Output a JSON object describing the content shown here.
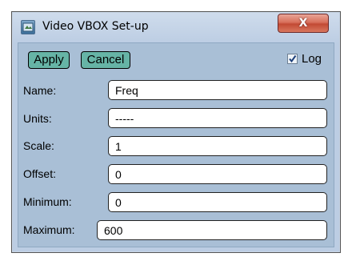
{
  "window": {
    "title": "Video VBOX Set-up",
    "close_label": "X"
  },
  "toolbar": {
    "apply_label": "Apply",
    "cancel_label": "Cancel",
    "log_label": "Log",
    "log_checked": true
  },
  "fields": [
    {
      "label": "Name:",
      "value": "Freq"
    },
    {
      "label": "Units:",
      "value": "-----"
    },
    {
      "label": "Scale:",
      "value": "1"
    },
    {
      "label": "Offset:",
      "value": "0"
    },
    {
      "label": "Minimum:",
      "value": "0"
    },
    {
      "label": "Maximum:",
      "value": "600"
    }
  ]
}
